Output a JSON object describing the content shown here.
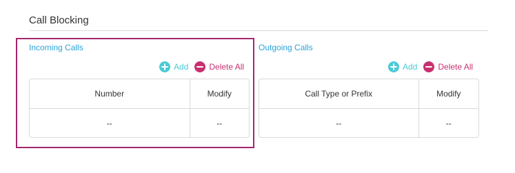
{
  "section": {
    "title": "Call Blocking"
  },
  "incoming": {
    "title": "Incoming Calls",
    "add_label": "Add",
    "delete_all_label": "Delete All",
    "columns": [
      "Number",
      "Modify"
    ],
    "rows": [
      [
        "--",
        "--"
      ]
    ]
  },
  "outgoing": {
    "title": "Outgoing Calls",
    "add_label": "Add",
    "delete_all_label": "Delete All",
    "columns": [
      "Call Type or Prefix",
      "Modify"
    ],
    "rows": [
      [
        "--",
        "--"
      ]
    ]
  },
  "icons": {
    "add": "plus-circle-icon",
    "delete": "minus-circle-icon"
  },
  "colors": {
    "accent": "#2aa3d8",
    "add": "#4acbd6",
    "delete": "#c8306f",
    "highlight": "#a3256d",
    "border": "#d9d9d9"
  }
}
